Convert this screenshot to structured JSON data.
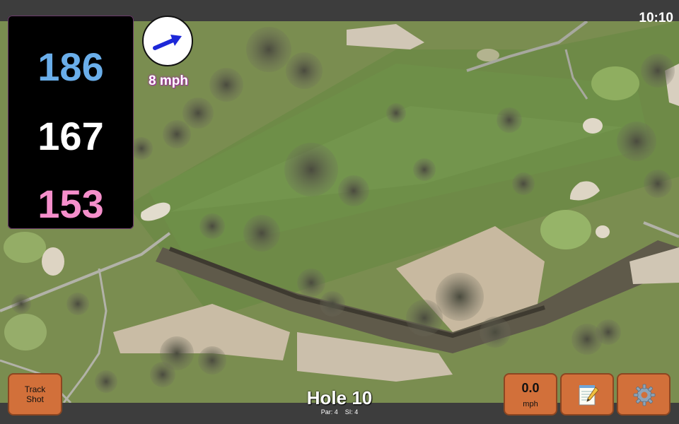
{
  "status_bar": {
    "time": "10:10"
  },
  "distances": {
    "back": "186",
    "middle": "167",
    "front": "153",
    "colors": {
      "back": "#6aaeea",
      "middle": "#ffffff",
      "front": "#f58fcb"
    }
  },
  "wind": {
    "speed_text": "8 mph",
    "arrow_icon": "wind-direction-arrow",
    "arrow_color": "#1d28d8"
  },
  "buttons": {
    "track_shot_label": "Track\nShot",
    "speed_value": "0.0",
    "speed_unit": "mph",
    "notes_icon": "notepad-icon",
    "settings_icon": "gear-icon",
    "accent": "#d2703a"
  },
  "hole": {
    "title": "Hole 10",
    "par_label": "Par: 4",
    "si_label": "SI: 4"
  },
  "map": {
    "type": "satellite-aerial-golf-course"
  }
}
